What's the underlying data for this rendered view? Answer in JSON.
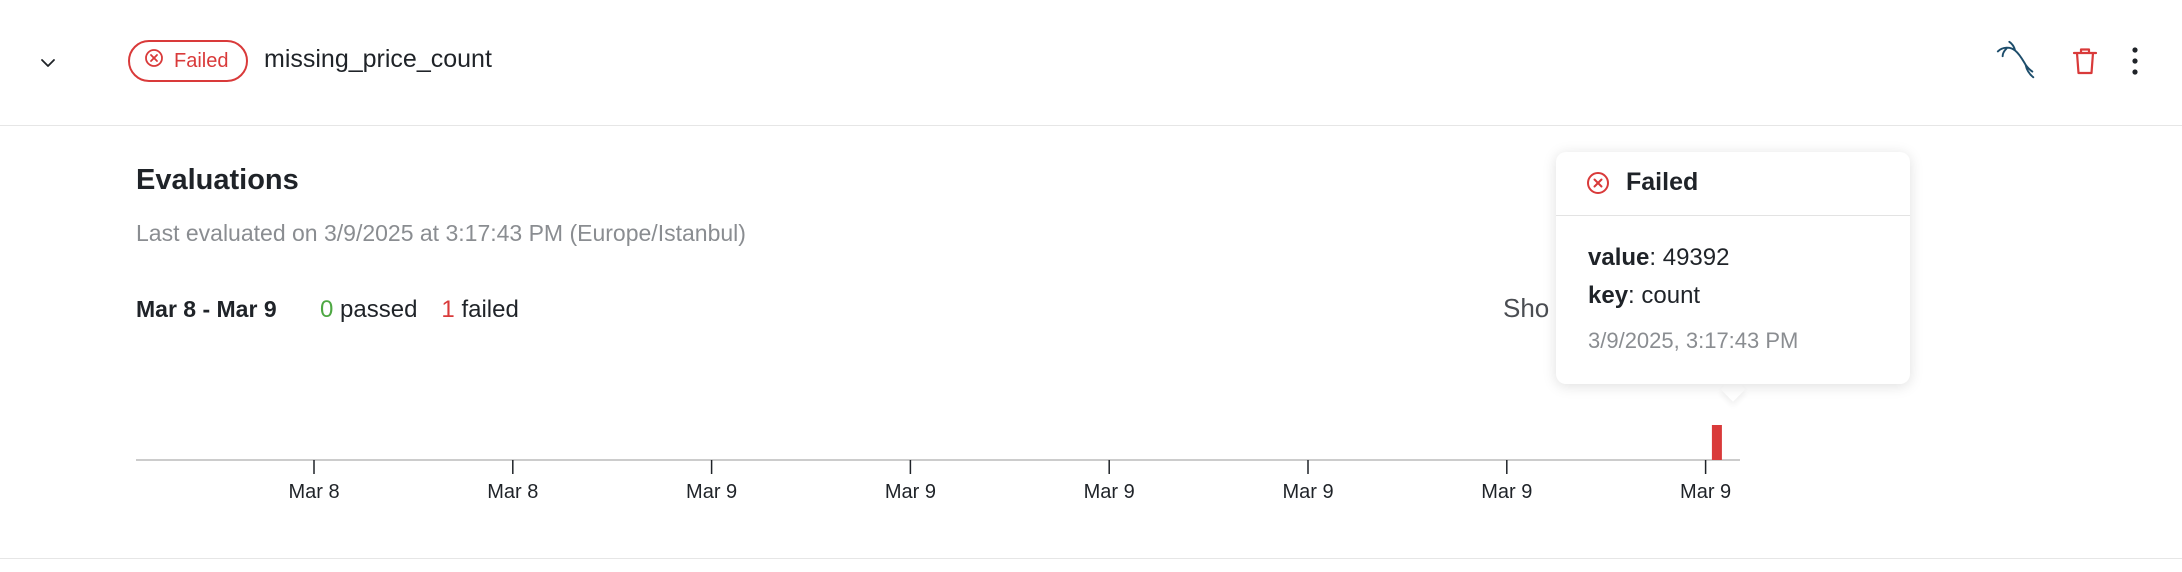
{
  "header": {
    "status_label": "Failed",
    "check_name": "missing_price_count",
    "icons": [
      "chevron-down-icon",
      "x-circle-icon",
      "mysql-dolphin-icon",
      "trash-icon",
      "more-vertical-icon"
    ]
  },
  "evaluations": {
    "title": "Evaluations",
    "last_evaluated": "Last evaluated on 3/9/2025 at 3:17:43 PM (Europe/Istanbul)",
    "range": "Mar 8 - Mar 9",
    "passed_count": "0",
    "passed_label": "passed",
    "failed_count": "1",
    "failed_label": "failed",
    "show_partial": "Sho"
  },
  "timeline": {
    "tick_labels": [
      "Mar 8",
      "Mar 8",
      "Mar 9",
      "Mar 9",
      "Mar 9",
      "Mar 9",
      "Mar 9",
      "Mar 9"
    ],
    "events": [
      {
        "status": "failed",
        "position_fraction": 0.9856
      }
    ],
    "colors": {
      "failed": "#d93a3a",
      "passed": "#4ea843",
      "axis": "#cccccc"
    }
  },
  "tooltip": {
    "status": "Failed",
    "value_key": "value",
    "value": "49392",
    "key_key": "key",
    "key_value": "count",
    "timestamp": "3/9/2025, 3:17:43 PM"
  },
  "colors": {
    "failed": "#d93a3a",
    "passed": "#4ea843",
    "muted_text": "#8a8d91",
    "mysql_icon": "#1d4d6b"
  }
}
